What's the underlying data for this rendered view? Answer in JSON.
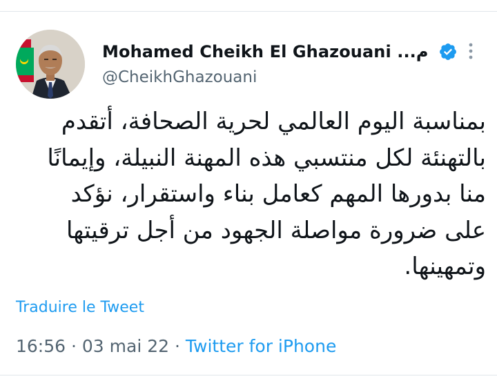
{
  "author": {
    "display_name": "Mohamed Cheikh El Ghazouani ...م",
    "handle": "@CheikhGhazouani",
    "verified": true,
    "verified_color": "#1d9bf0"
  },
  "tweet": {
    "lines": [
      "بمناسبة اليوم العالمي لحرية الصحافة، أتقدم",
      "بالتهنئة لكل منتسبي هذه المهنة النبيلة، وإيمانًا",
      "منا  بدورها المهم كعامل بناء واستقرار، نؤكد",
      "على ضرورة مواصلة الجهود من أجل ترقيتها",
      "وتمهينها."
    ],
    "translate_label": "Traduire le Tweet"
  },
  "meta": {
    "time": "16:56",
    "separator": " · ",
    "date": "03 mai 22",
    "source": "Twitter for iPhone"
  },
  "icons": {
    "avatar": "avatar-photo",
    "verified": "verified-badge-icon",
    "more": "more-options-icon"
  },
  "colors": {
    "text": "#0f1419",
    "secondary": "#536471",
    "link": "#1d9bf0",
    "border": "#e1e6ea"
  }
}
